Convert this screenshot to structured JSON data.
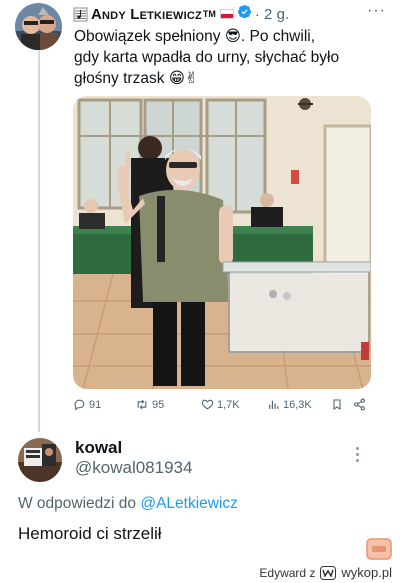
{
  "tweet": {
    "author": "Andy Letkiewicz",
    "tm": "TM",
    "time": "· 2 g.",
    "more": "···",
    "text_line1": "Obowiązek spełniony 😎. Po chwili,",
    "text_line2": "gdy karta wpadła do urny, słychać było",
    "text_line3": "głośny trzask 😁✌",
    "stats": {
      "replies": "91",
      "reposts": "95",
      "likes": "1,7K",
      "views": "16,3K"
    }
  },
  "reply": {
    "name": "kowal",
    "handle": "@kowal081934",
    "reply_to_prefix": "W odpowiedzi do ",
    "reply_to_handle": "@ALetkiewicz",
    "text": "Hemoroid ci strzelił"
  },
  "footer": {
    "user": "Edyward",
    "z": "z",
    "site": "wykop.pl"
  },
  "colors": {
    "accent": "#1d9bf0",
    "muted": "#536471",
    "flag_red": "#dc143c"
  }
}
